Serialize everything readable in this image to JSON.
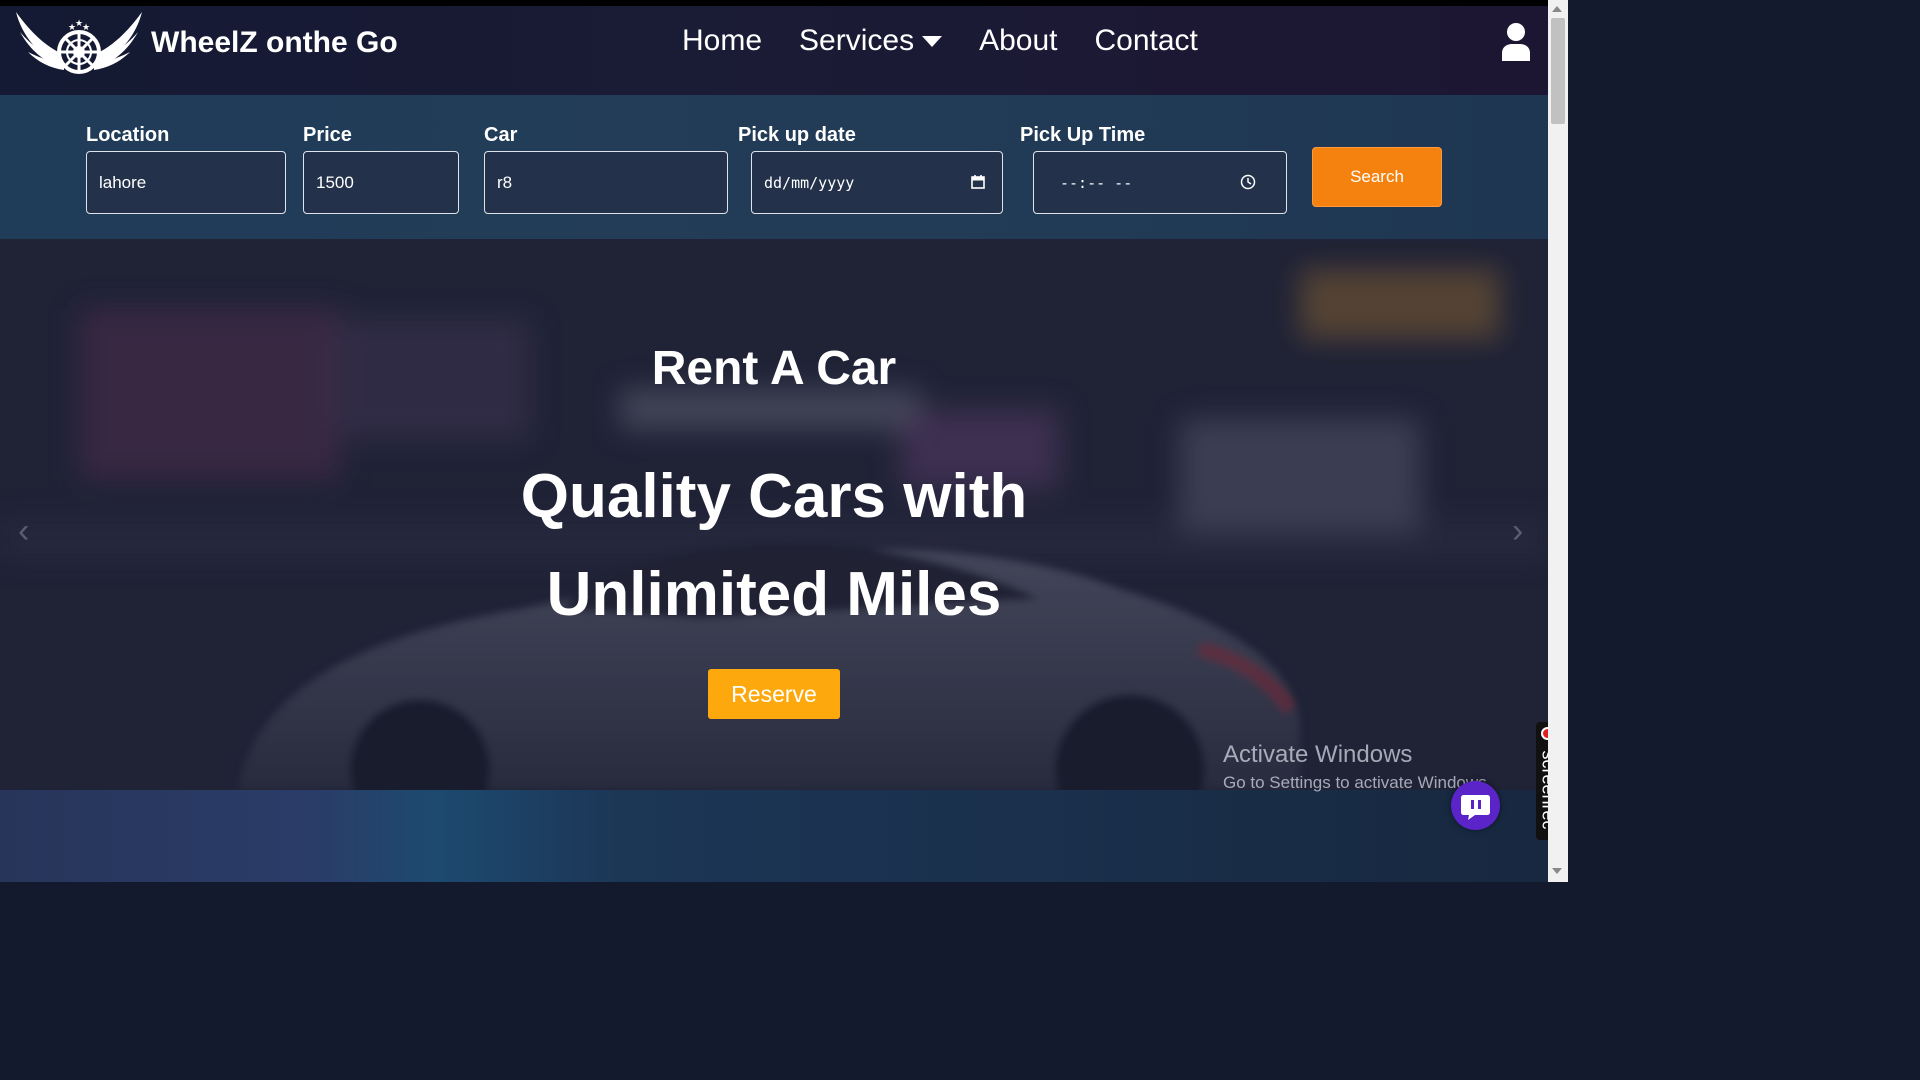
{
  "brand": {
    "name": "WheelZ onthe Go"
  },
  "nav": {
    "home": "Home",
    "services": "Services",
    "about": "About",
    "contact": "Contact"
  },
  "search": {
    "location_label": "Location",
    "location_value": "lahore",
    "price_label": "Price",
    "price_value": "1500",
    "car_label": "Car",
    "car_value": "r8",
    "date_label": "Pick up date",
    "date_value": "dd/mm/yyyy",
    "time_label": "Pick Up Time",
    "time_value": "--:-- --",
    "button": "Search"
  },
  "hero": {
    "subtitle": "Rent A Car",
    "title_line1": "Quality Cars with",
    "title_line2": "Unlimited Miles",
    "reserve": "Reserve",
    "prev_arrow": "‹",
    "next_arrow": "›"
  },
  "overlay": {
    "activate_title": "Activate Windows",
    "activate_sub": "Go to Settings to activate Windows.",
    "screenrec": "screenrec"
  },
  "colors": {
    "accent_orange": "#f5820e",
    "reserve_yellow": "#fda90e",
    "nav_bg": "#141a33"
  },
  "icons": {
    "logo": "winged-wheel-logo",
    "user": "user-icon",
    "calendar": "calendar-icon",
    "clock": "clock-icon",
    "chat": "chat-icon"
  }
}
